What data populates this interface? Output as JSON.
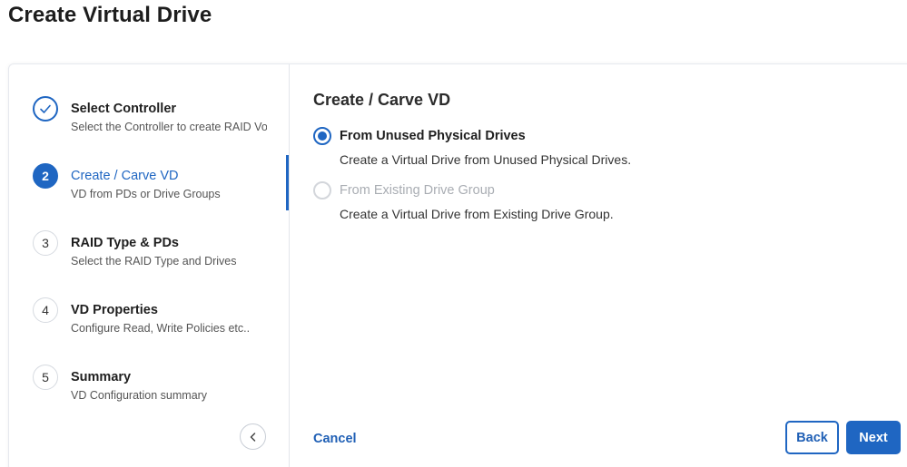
{
  "page": {
    "title": "Create Virtual Drive"
  },
  "steps": [
    {
      "number": "✓",
      "title": "Select Controller",
      "subtitle": "Select the Controller to create RAID Vo",
      "state": "done"
    },
    {
      "number": "2",
      "title": "Create / Carve VD",
      "subtitle": "VD from PDs or Drive Groups",
      "state": "active"
    },
    {
      "number": "3",
      "title": "RAID Type & PDs",
      "subtitle": "Select the RAID Type and Drives",
      "state": "pending"
    },
    {
      "number": "4",
      "title": "VD Properties",
      "subtitle": "Configure Read, Write Policies etc..",
      "state": "pending"
    },
    {
      "number": "5",
      "title": "Summary",
      "subtitle": "VD Configuration summary",
      "state": "pending"
    }
  ],
  "content": {
    "title": "Create / Carve VD",
    "options": [
      {
        "label": "From Unused Physical Drives",
        "description": "Create a Virtual Drive from Unused Physical Drives.",
        "selected": true,
        "disabled": false
      },
      {
        "label": "From Existing Drive Group",
        "description": "Create a Virtual Drive from Existing Drive Group.",
        "selected": false,
        "disabled": true
      }
    ]
  },
  "actions": {
    "cancel": "Cancel",
    "back": "Back",
    "next": "Next"
  },
  "icons": {
    "done_step": "check-icon",
    "collapse": "chevron-left-icon"
  },
  "colors": {
    "accent": "#1f66c2"
  }
}
